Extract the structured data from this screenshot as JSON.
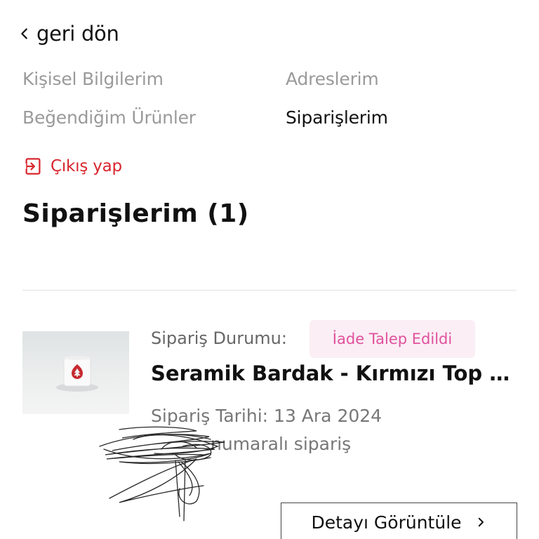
{
  "nav": {
    "back_label": "geri dön",
    "back_icon": "chevron-left-icon"
  },
  "account_menu": {
    "items": [
      {
        "label": "Kişisel Bilgilerim",
        "active": false
      },
      {
        "label": "Adreslerim",
        "active": false
      },
      {
        "label": "Beğendiğim Ürünler",
        "active": false
      },
      {
        "label": "Siparişlerim",
        "active": true
      }
    ],
    "logout_label": "Çıkış yap",
    "logout_icon": "logout-icon"
  },
  "page": {
    "title": "Siparişlerim (1)"
  },
  "orders": [
    {
      "status_label": "Sipariş Durumu:",
      "status_value": "İade Talep Edildi",
      "product_name": "Seramik Bardak - Kırmızı Top Ağaç",
      "date_text": "Sipariş Tarihi: 13 Ara 2024",
      "number_text": "numaralı sipariş",
      "detail_button": "Detayı Görüntüle"
    }
  ],
  "colors": {
    "accent_red": "#d8262e",
    "badge_bg": "#fbeef5",
    "badge_text": "#e0519d",
    "muted_text": "#9a9a9a"
  }
}
